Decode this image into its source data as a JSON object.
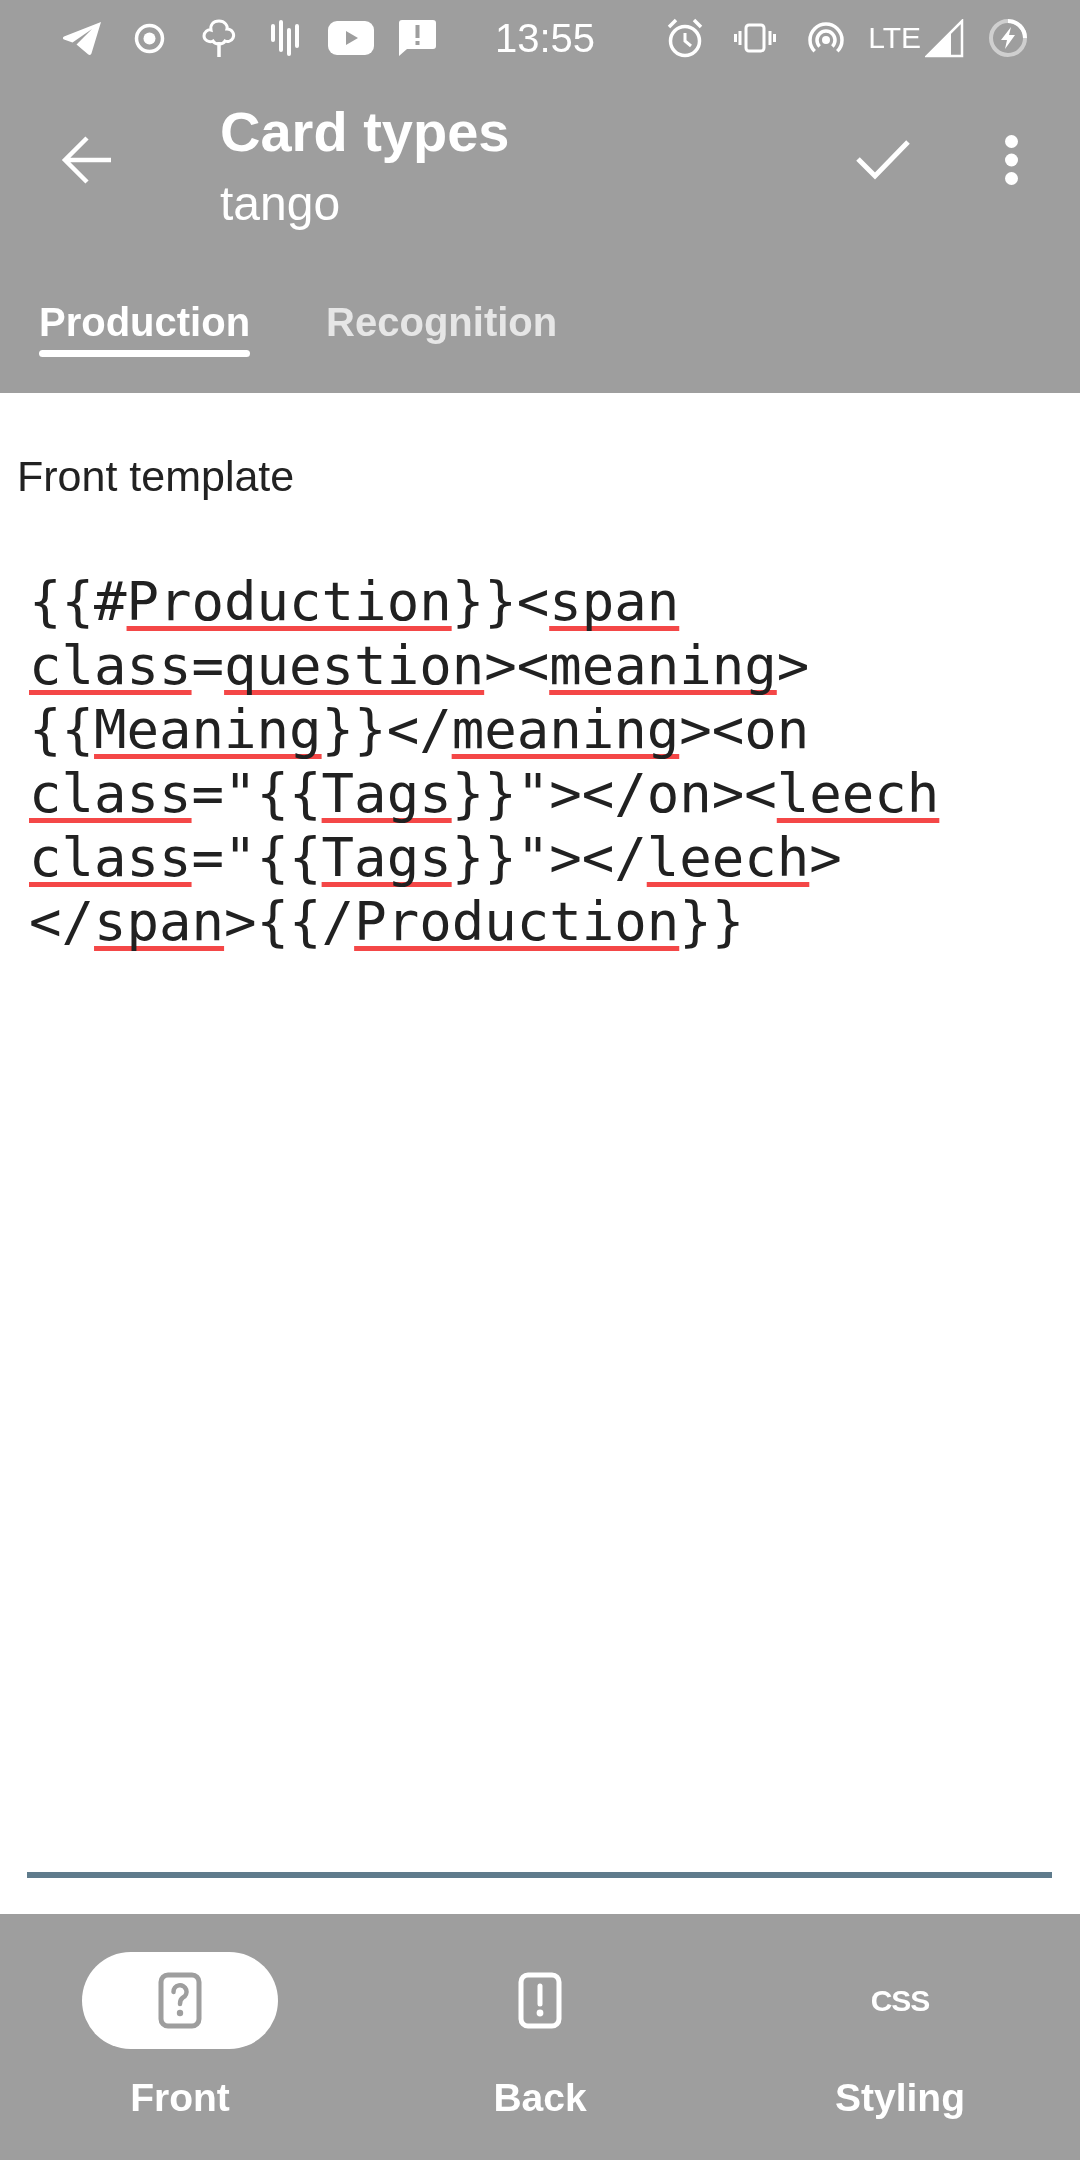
{
  "status_bar": {
    "time": "13:55",
    "network": "LTE"
  },
  "app_bar": {
    "title": "Card types",
    "subtitle": "tango"
  },
  "tabs": [
    {
      "label": "Production",
      "selected": true
    },
    {
      "label": "Recognition",
      "selected": false
    }
  ],
  "front_template": {
    "label": "Front template",
    "segments": [
      {
        "text": "{{#",
        "flagged": false
      },
      {
        "text": "Production",
        "flagged": true
      },
      {
        "text": "}}<",
        "flagged": false
      },
      {
        "text": "span ",
        "flagged": true
      },
      {
        "text": "class",
        "flagged": true
      },
      {
        "text": "=",
        "flagged": false
      },
      {
        "text": "question",
        "flagged": true
      },
      {
        "text": "><",
        "flagged": false
      },
      {
        "text": "meaning",
        "flagged": true
      },
      {
        "text": ">{{",
        "flagged": false
      },
      {
        "text": "Meaning",
        "flagged": true
      },
      {
        "text": "}}</",
        "flagged": false
      },
      {
        "text": "meaning",
        "flagged": true
      },
      {
        "text": "><on ",
        "flagged": false
      },
      {
        "text": "class",
        "flagged": true
      },
      {
        "text": "=\"{{",
        "flagged": false
      },
      {
        "text": "Tags",
        "flagged": true
      },
      {
        "text": "}}\"></on><",
        "flagged": false
      },
      {
        "text": "leech ",
        "flagged": true
      },
      {
        "text": "class",
        "flagged": true
      },
      {
        "text": "=\"{{",
        "flagged": false
      },
      {
        "text": "Tags",
        "flagged": true
      },
      {
        "text": "}}\"></",
        "flagged": false
      },
      {
        "text": "leech",
        "flagged": true
      },
      {
        "text": "></",
        "flagged": false
      },
      {
        "text": "span",
        "flagged": true
      },
      {
        "text": ">{{/",
        "flagged": false
      },
      {
        "text": "Production",
        "flagged": true
      },
      {
        "text": "}}",
        "flagged": false
      }
    ]
  },
  "bottom_nav": [
    {
      "label": "Front",
      "selected": true
    },
    {
      "label": "Back",
      "selected": false
    },
    {
      "label": "Styling",
      "selected": false,
      "icon_text": "CSS"
    }
  ]
}
